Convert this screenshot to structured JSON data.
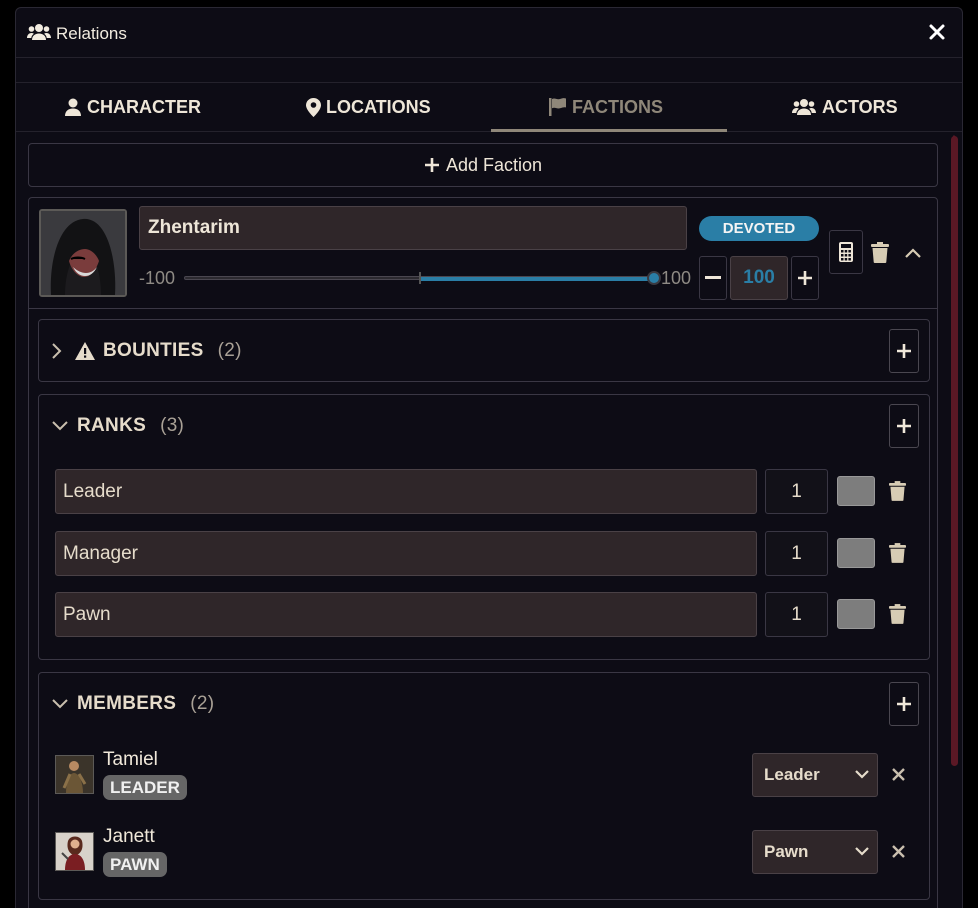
{
  "window": {
    "title": "Relations",
    "title_icon": "users-icon",
    "close_icon": "close-icon"
  },
  "tabs": [
    {
      "label": "CHARACTER",
      "icon": "user-icon",
      "active": false
    },
    {
      "label": "LOCATIONS",
      "icon": "map-pin-icon",
      "active": false
    },
    {
      "label": "FACTIONS",
      "icon": "flag-icon",
      "active": true
    },
    {
      "label": "ACTORS",
      "icon": "users-icon",
      "active": false
    }
  ],
  "add_faction": {
    "label": "Add Faction"
  },
  "faction": {
    "name": "Zhentarim",
    "status_badge": "DEVOTED",
    "status_color": "#2a7ea6",
    "slider": {
      "min_label": "-100",
      "max_label": "100",
      "value": 100,
      "min": -100,
      "max": 100
    },
    "stepper_value": "100"
  },
  "sections": {
    "bounties": {
      "label": "BOUNTIES",
      "count": "(2)",
      "expanded": false
    },
    "ranks": {
      "label": "RANKS",
      "count": "(3)",
      "expanded": true
    },
    "members": {
      "label": "MEMBERS",
      "count": "(2)",
      "expanded": true
    }
  },
  "ranks": [
    {
      "name": "Leader",
      "value": "1",
      "color": "#7d7d7d"
    },
    {
      "name": "Manager",
      "value": "1",
      "color": "#7d7d7d"
    },
    {
      "name": "Pawn",
      "value": "1",
      "color": "#7d7d7d"
    }
  ],
  "members": [
    {
      "name": "Tamiel",
      "role_badge": "LEADER",
      "rank_select": "Leader"
    },
    {
      "name": "Janett",
      "role_badge": "PAWN",
      "rank_select": "Pawn"
    }
  ]
}
